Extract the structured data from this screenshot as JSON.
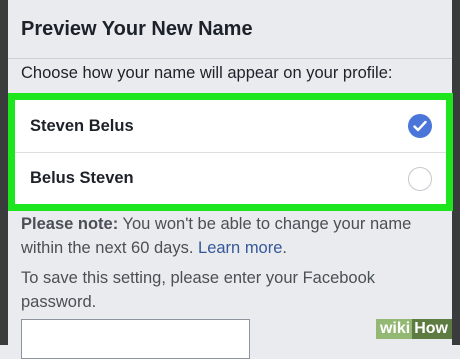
{
  "header": {
    "title": "Preview Your New Name"
  },
  "prompt": "Choose how your name will appear on your profile:",
  "options": [
    {
      "label": "Steven Belus",
      "selected": true
    },
    {
      "label": "Belus Steven",
      "selected": false
    }
  ],
  "note": {
    "bold": "Please note:",
    "text": " You won't be able to change your name within the next 60 days. ",
    "link": "Learn more",
    "suffix": "."
  },
  "save_text": "To save this setting, please enter your Facebook password.",
  "watermark": {
    "wiki": "wiki",
    "how": "How"
  },
  "colors": {
    "highlight": "#1ee61e",
    "radio_checked": "#4a76d9",
    "link": "#365899"
  }
}
